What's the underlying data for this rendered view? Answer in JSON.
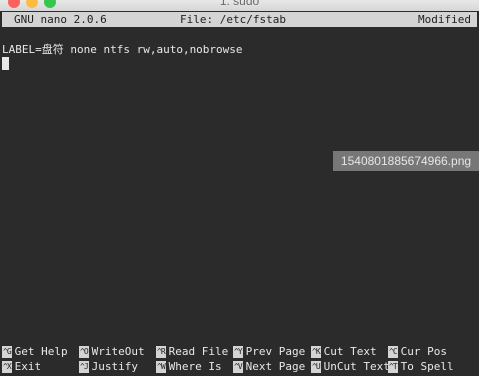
{
  "window": {
    "title": "1. sudo",
    "colors": {
      "close": "#fc605c",
      "minimize": "#fdbc40",
      "zoom": "#34c84a"
    }
  },
  "nano": {
    "version": "GNU nano 2.0.6",
    "file": "File: /etc/fstab",
    "status": "Modified"
  },
  "buffer": {
    "lines": [
      "LABEL=盘符 none ntfs rw,auto,nobrowse"
    ]
  },
  "overlay": {
    "filename": "1540801885674966.png"
  },
  "shortcuts": {
    "row1": [
      {
        "key": "^G",
        "label": "Get Help"
      },
      {
        "key": "^O",
        "label": "WriteOut"
      },
      {
        "key": "^R",
        "label": "Read File"
      },
      {
        "key": "^Y",
        "label": "Prev Page"
      },
      {
        "key": "^K",
        "label": "Cut Text"
      },
      {
        "key": "^C",
        "label": "Cur Pos"
      }
    ],
    "row2": [
      {
        "key": "^X",
        "label": "Exit"
      },
      {
        "key": "^J",
        "label": "Justify"
      },
      {
        "key": "^W",
        "label": "Where Is"
      },
      {
        "key": "^V",
        "label": "Next Page"
      },
      {
        "key": "^U",
        "label": "UnCut Text"
      },
      {
        "key": "^T",
        "label": "To Spell"
      }
    ]
  }
}
